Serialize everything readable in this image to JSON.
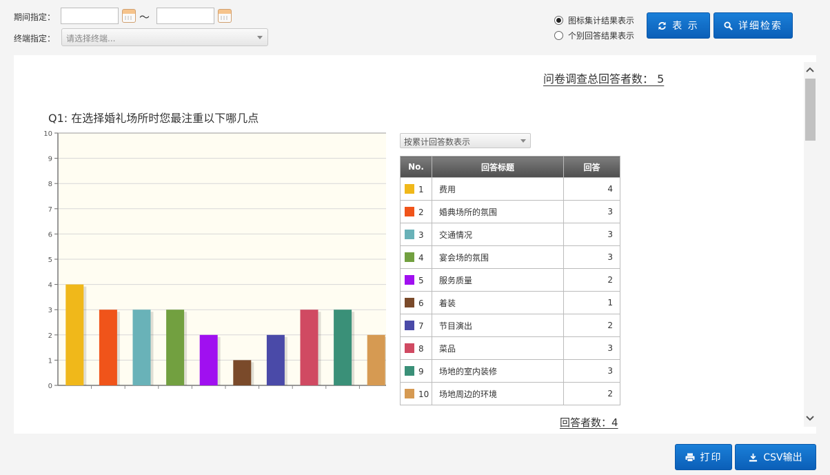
{
  "filters": {
    "period_label": "期间指定：",
    "tilde": "～",
    "terminal_label": "终端指定：",
    "terminal_placeholder": "请选择终端..."
  },
  "view_options": {
    "option1": "图标集计结果表示",
    "option2": "个别回答结果表示",
    "selected": 1
  },
  "buttons": {
    "show": "表 示",
    "detail_search": "详细检索",
    "print": "打印",
    "csv": "CSV输出"
  },
  "summary": {
    "total_label": "问卷调查总回答者数： 5"
  },
  "question": {
    "title": "Q1: 在选择婚礼场所时您最注重以下哪几点",
    "aggregate_select": "按累计回答数表示",
    "table_headers": {
      "no": "No.",
      "title": "回答标题",
      "count": "回答"
    },
    "respondents_label": "回答者数：4"
  },
  "chart_data": {
    "type": "bar",
    "categories": [
      "1",
      "2",
      "3",
      "4",
      "5",
      "6",
      "7",
      "8",
      "9",
      "10"
    ],
    "values": [
      4,
      3,
      3,
      3,
      2,
      1,
      2,
      3,
      3,
      2
    ],
    "labels": [
      "费用",
      "婚典场所的氛围",
      "交通情况",
      "宴会场的氛围",
      "服务质量",
      "着装",
      "节目演出",
      "菜品",
      "场地的室内装修",
      "场地周边的环境"
    ],
    "colors": [
      "#f0b81a",
      "#f0541a",
      "#69b2b8",
      "#72a040",
      "#a010f0",
      "#7a4a2a",
      "#4a4aa8",
      "#d04a62",
      "#3a9078",
      "#d69a52"
    ],
    "yticks": [
      "0",
      "1",
      "2",
      "3",
      "4",
      "5",
      "6",
      "7",
      "8",
      "9",
      "10"
    ],
    "ylim": [
      0,
      10
    ],
    "grid": true,
    "plot_background": "#fffdf2"
  }
}
